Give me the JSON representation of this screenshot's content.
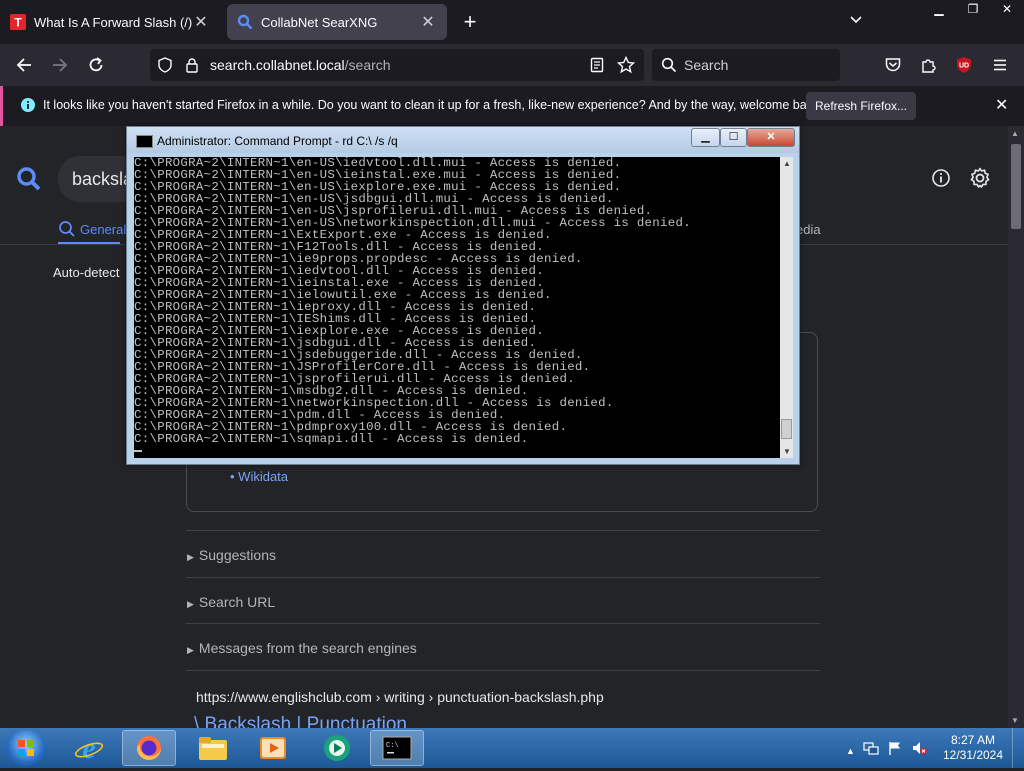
{
  "browser": {
    "tabs": [
      {
        "title": "What Is A Forward Slash (/) & H",
        "active": false,
        "favicon": "t-icon"
      },
      {
        "title": "CollabNet SearXNG",
        "active": true,
        "favicon": "searxng-icon"
      }
    ],
    "url": {
      "host": "search.collabnet.local",
      "path": "/search"
    },
    "search_placeholder": "Search",
    "notification": {
      "text": "It looks like you haven't started Firefox in a while. Do you want to clean it up for a fresh, like-new experience? And by the way, welcome back!",
      "button": "Refresh Firefox..."
    }
  },
  "page": {
    "query": "backsla",
    "category_general": "General",
    "category_media": "edia",
    "language": "Auto-detect",
    "infobox_link": "Wikidata",
    "folds": [
      "Suggestions",
      "Search URL",
      "Messages from the search engines"
    ],
    "result": {
      "url": "https://www.englishclub.com  › writing › punctuation-backslash.php",
      "title": "\\ Backslash | Punctuation"
    }
  },
  "cmd": {
    "title": "Administrator: Command Prompt - rd  C:\\ /s /q",
    "lines": [
      "C:\\PROGRA~2\\INTERN~1\\en-US\\iedvtool.dll.mui - Access is denied.",
      "C:\\PROGRA~2\\INTERN~1\\en-US\\ieinstal.exe.mui - Access is denied.",
      "C:\\PROGRA~2\\INTERN~1\\en-US\\iexplore.exe.mui - Access is denied.",
      "C:\\PROGRA~2\\INTERN~1\\en-US\\jsdbgui.dll.mui - Access is denied.",
      "C:\\PROGRA~2\\INTERN~1\\en-US\\jsprofilerui.dll.mui - Access is denied.",
      "C:\\PROGRA~2\\INTERN~1\\en-US\\networkinspection.dll.mui - Access is denied.",
      "C:\\PROGRA~2\\INTERN~1\\ExtExport.exe - Access is denied.",
      "C:\\PROGRA~2\\INTERN~1\\F12Tools.dll - Access is denied.",
      "C:\\PROGRA~2\\INTERN~1\\ie9props.propdesc - Access is denied.",
      "C:\\PROGRA~2\\INTERN~1\\iedvtool.dll - Access is denied.",
      "C:\\PROGRA~2\\INTERN~1\\ieinstal.exe - Access is denied.",
      "C:\\PROGRA~2\\INTERN~1\\ielowutil.exe - Access is denied.",
      "C:\\PROGRA~2\\INTERN~1\\ieproxy.dll - Access is denied.",
      "C:\\PROGRA~2\\INTERN~1\\IEShims.dll - Access is denied.",
      "C:\\PROGRA~2\\INTERN~1\\iexplore.exe - Access is denied.",
      "C:\\PROGRA~2\\INTERN~1\\jsdbgui.dll - Access is denied.",
      "C:\\PROGRA~2\\INTERN~1\\jsdebuggeride.dll - Access is denied.",
      "C:\\PROGRA~2\\INTERN~1\\JSProfilerCore.dll - Access is denied.",
      "C:\\PROGRA~2\\INTERN~1\\jsprofilerui.dll - Access is denied.",
      "C:\\PROGRA~2\\INTERN~1\\msdbg2.dll - Access is denied.",
      "C:\\PROGRA~2\\INTERN~1\\networkinspection.dll - Access is denied.",
      "C:\\PROGRA~2\\INTERN~1\\pdm.dll - Access is denied.",
      "C:\\PROGRA~2\\INTERN~1\\pdmproxy100.dll - Access is denied.",
      "C:\\PROGRA~2\\INTERN~1\\sqmapi.dll - Access is denied."
    ]
  },
  "taskbar": {
    "items": [
      "internet-explorer-icon",
      "firefox-icon",
      "file-explorer-icon",
      "media-player-icon",
      "app-icon",
      "command-prompt-icon"
    ],
    "time": "8:27 AM",
    "date": "12/31/2024"
  },
  "colors": {
    "accent": "#5e8cf7",
    "link": "#7aa2f7",
    "notification_bar": "#e0559b"
  }
}
